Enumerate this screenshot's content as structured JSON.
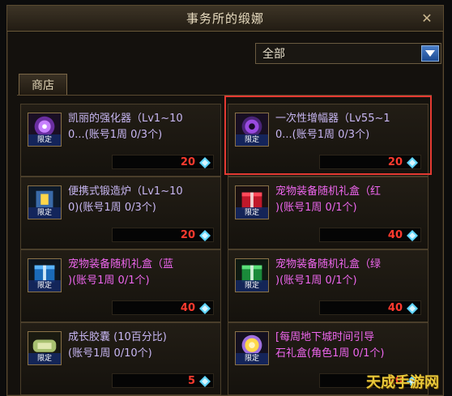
{
  "window": {
    "title": "事务所的缎娜"
  },
  "filter": {
    "selected": "全部"
  },
  "tabs": [
    {
      "label": "商店"
    }
  ],
  "items": [
    {
      "name": "凯丽的强化器（Lv1~100...(账号1周 0/3个)",
      "line1": "凯丽的强化器（Lv1~10",
      "line2": "0...(账号1周 0/3个)",
      "price": "20",
      "tag": "限定",
      "color": "#c7b6f2",
      "icon": "purple-orb-icon"
    },
    {
      "name": "一次性增幅器（Lv55~100...(账号1周 0/3个)",
      "line1": "一次性增幅器（Lv55~1",
      "line2": "0...(账号1周 0/3个)",
      "price": "20",
      "tag": "限定",
      "color": "#c7b6f2",
      "icon": "purple-orb-icon"
    },
    {
      "name": "便携式锻造炉（Lv1~100)(账号1周 0/3个)",
      "line1": "便携式锻造炉（Lv1~10",
      "line2": "0)(账号1周 0/3个)",
      "price": "20",
      "tag": "限定",
      "color": "#c7b6f2",
      "icon": "forge-icon"
    },
    {
      "name": "宠物装备随机礼盒（红)(账号1周 0/1个)",
      "line1": "宠物装备随机礼盒（红",
      "line2": ")(账号1周 0/1个)",
      "price": "40",
      "tag": "限定",
      "color": "#ee66ee",
      "icon": "red-gift-box-icon"
    },
    {
      "name": "宠物装备随机礼盒（蓝)(账号1周 0/1个)",
      "line1": "宠物装备随机礼盒（蓝",
      "line2": ")(账号1周 0/1个)",
      "price": "40",
      "tag": "限定",
      "color": "#ee66ee",
      "icon": "blue-gift-box-icon"
    },
    {
      "name": "宠物装备随机礼盒（绿)(账号1周 0/1个)",
      "line1": "宠物装备随机礼盒（绿",
      "line2": ")(账号1周 0/1个)",
      "price": "40",
      "tag": "限定",
      "color": "#ee66ee",
      "icon": "green-gift-box-icon"
    },
    {
      "name": "成长胶囊 (10百分比)(账号1周 0/10个)",
      "line1": "成长胶囊 (10百分比)",
      "line2": "(账号1周 0/10个)",
      "price": "5",
      "tag": "限定",
      "color": "#c7b6f2",
      "icon": "scroll-icon"
    },
    {
      "name": "[每周地下城时间引导石礼盒(角色1周 0/1个)",
      "line1": "[每周地下城时间引导",
      "line2": "石礼盒(角色1周 0/1个)",
      "price": "20",
      "tag": "限定",
      "color": "#ee66ee",
      "icon": "gold-orb-icon"
    }
  ],
  "colors": {
    "price": "#ff3a2e",
    "highlight": "#e43a32",
    "gem": "#5fd6ff"
  },
  "watermark": "天成手游网"
}
